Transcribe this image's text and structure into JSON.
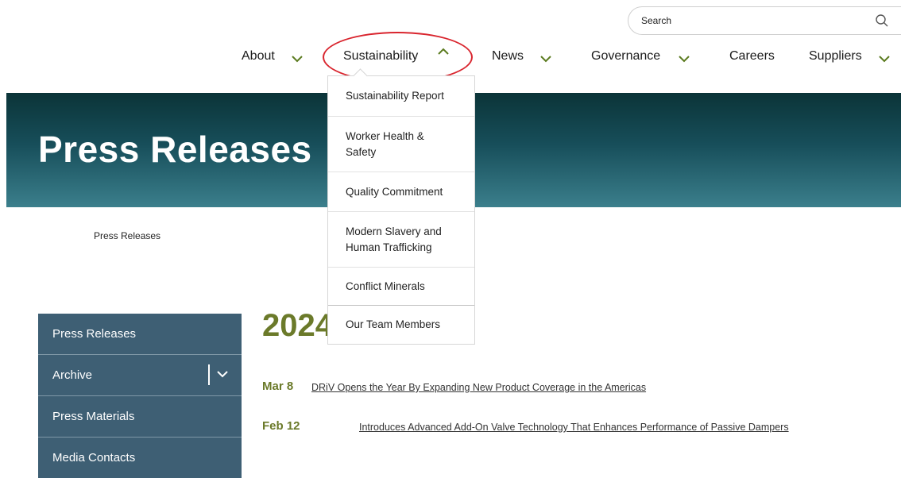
{
  "search": {
    "placeholder": "Search",
    "icon": "search-icon"
  },
  "nav": {
    "items": [
      {
        "label": "About",
        "icon": "chevron-down-icon"
      },
      {
        "label": "Sustainability",
        "icon": "chevron-up-icon"
      },
      {
        "label": "News",
        "icon": "chevron-down-icon"
      },
      {
        "label": "Governance",
        "icon": "chevron-down-icon"
      },
      {
        "label": "Careers"
      },
      {
        "label": "Suppliers",
        "icon": "chevron-down-icon"
      }
    ],
    "chevron_color": "#5a7a1e",
    "highlight_color": "#d9252e"
  },
  "hero": {
    "title": "Press Releases"
  },
  "dropdown": {
    "items": [
      {
        "label": "Sustainability Report"
      },
      {
        "label": "Worker Health &\nSafety"
      },
      {
        "label": "Quality Commitment"
      },
      {
        "label": "Modern Slavery and\nHuman Trafficking"
      },
      {
        "label": "Conflict Minerals"
      },
      {
        "label": "Our Team Members"
      }
    ]
  },
  "breadcrumb": {
    "current": "Press Releases"
  },
  "sidebar": {
    "items": [
      {
        "label": "Press Releases"
      },
      {
        "label": "Archive",
        "icon": "chevron-down-icon"
      },
      {
        "label": "Press Materials"
      },
      {
        "label": "Media Contacts"
      }
    ],
    "bg_color": "#3e5f74"
  },
  "main": {
    "year": "2024",
    "releases": [
      {
        "date": "Mar 8",
        "title": "DRiV Opens the Year By Expanding New Product Coverage in the Americas"
      },
      {
        "date": "Feb 12",
        "title": "Introduces Advanced Add-On Valve Technology That Enhances Performance of Passive Dampers"
      }
    ],
    "accent_color": "#6b7a2a"
  }
}
